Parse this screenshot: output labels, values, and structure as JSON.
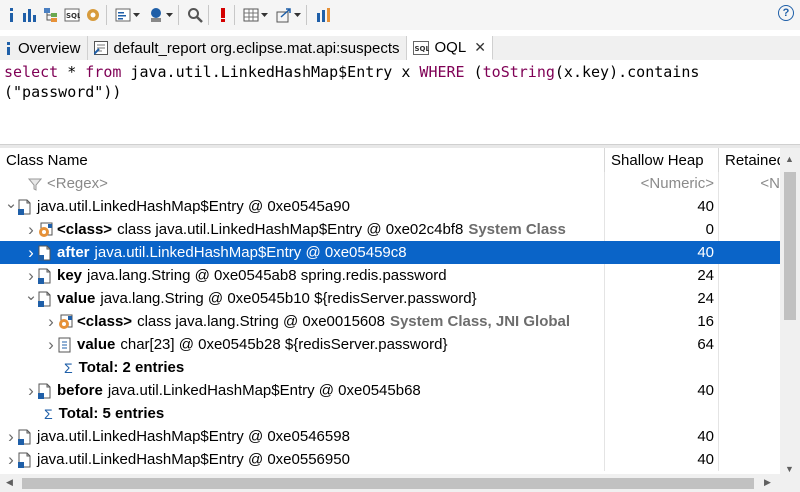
{
  "toolbar": {
    "icons": [
      "info-icon",
      "histogram-icon",
      "dominator-tree-icon",
      "oql-icon",
      "heap-dump-overview-icon",
      "query-browser-icon",
      "find-object-icon",
      "search-icon",
      "leak-suspects-icon",
      "calculate-icon",
      "export-icon",
      "debug-icon",
      "help-icon"
    ]
  },
  "tabs": [
    {
      "label": "Overview",
      "icon": "info-icon",
      "active": false
    },
    {
      "label": "default_report  org.eclipse.mat.api:suspects",
      "icon": "report-icon",
      "active": false
    },
    {
      "label": "OQL",
      "icon": "oql-icon",
      "active": true
    }
  ],
  "query": {
    "line1": {
      "kw1": "select",
      "p1": " * ",
      "kw2": "from",
      "p2": " java.util.LinkedHashMap$Entry x ",
      "kw3": "WHERE",
      "p3": " (",
      "kw4": "toString",
      "p4": "(x.key).contains"
    },
    "line2": "(\"password\"))"
  },
  "table": {
    "columns": [
      "Class Name",
      "Shallow Heap",
      "Retained"
    ],
    "filter": {
      "regex": "<Regex>",
      "numeric": "<Numeric>",
      "numeric2": "<N"
    },
    "rows": [
      {
        "indent": 0,
        "twisty": "v",
        "icon": "object-icon",
        "bold": "",
        "text": "java.util.LinkedHashMap$Entry @ 0xe0545a90",
        "suffix": "",
        "shallow": "40",
        "selected": false
      },
      {
        "indent": 1,
        "twisty": ">",
        "icon": "class-icon",
        "bold": "<class>",
        "text": "class java.util.LinkedHashMap$Entry @ 0xe02c4bf8",
        "suffix": "System Class",
        "shallow": "0",
        "selected": false
      },
      {
        "indent": 1,
        "twisty": ">",
        "icon": "object-icon",
        "bold": "after",
        "text": "java.util.LinkedHashMap$Entry @ 0xe05459c8",
        "suffix": "",
        "shallow": "40",
        "selected": true
      },
      {
        "indent": 1,
        "twisty": ">",
        "icon": "object-icon",
        "bold": "key",
        "text": "java.lang.String @ 0xe0545ab8  spring.redis.password",
        "suffix": "",
        "shallow": "24",
        "selected": false
      },
      {
        "indent": 1,
        "twisty": "v",
        "icon": "object-icon",
        "bold": "value",
        "text": "java.lang.String @ 0xe0545b10  ${redisServer.password}",
        "suffix": "",
        "shallow": "24",
        "selected": false
      },
      {
        "indent": 2,
        "twisty": ">",
        "icon": "class-icon",
        "bold": "<class>",
        "text": "class java.lang.String @ 0xe0015608",
        "suffix": "System Class, JNI Global",
        "shallow": "16",
        "selected": false
      },
      {
        "indent": 2,
        "twisty": ">",
        "icon": "array-icon",
        "bold": "value",
        "text": "char[23] @ 0xe0545b28  ${redisServer.password}",
        "suffix": "",
        "shallow": "64",
        "selected": false
      },
      {
        "indent": 2,
        "twisty": "",
        "icon": "sigma-icon",
        "bold": "Total: 2 entries",
        "text": "",
        "suffix": "",
        "shallow": "",
        "selected": false
      },
      {
        "indent": 1,
        "twisty": ">",
        "icon": "object-icon",
        "bold": "before",
        "text": "java.util.LinkedHashMap$Entry @ 0xe0545b68",
        "suffix": "",
        "shallow": "40",
        "selected": false
      },
      {
        "indent": 1,
        "twisty": "",
        "icon": "sigma-icon",
        "bold": "Total: 5 entries",
        "text": "",
        "suffix": "",
        "shallow": "",
        "selected": false
      },
      {
        "indent": 0,
        "twisty": ">",
        "icon": "object-icon",
        "bold": "",
        "text": "java.util.LinkedHashMap$Entry @ 0xe0546598",
        "suffix": "",
        "shallow": "40",
        "selected": false
      },
      {
        "indent": 0,
        "twisty": ">",
        "icon": "object-icon",
        "bold": "",
        "text": "java.util.LinkedHashMap$Entry @ 0xe0556950",
        "suffix": "",
        "shallow": "40",
        "selected": false
      }
    ]
  }
}
